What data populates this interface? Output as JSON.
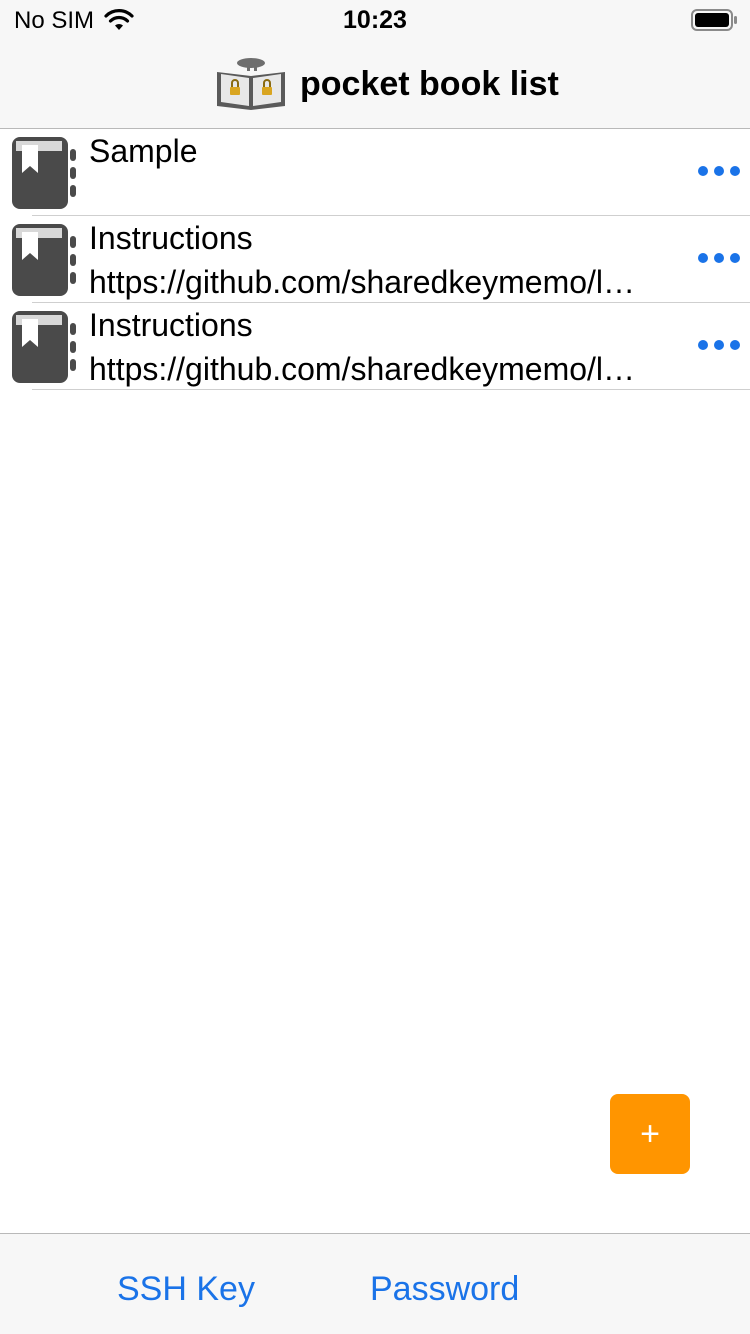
{
  "status_bar": {
    "carrier": "No SIM",
    "time": "10:23",
    "wifi_icon": "wifi-icon",
    "battery_icon": "battery-icon"
  },
  "nav": {
    "logo_icon": "book-lock-logo-icon",
    "title": "pocket book list"
  },
  "books": [
    {
      "title": "Sample",
      "subtitle": "",
      "icon": "book-icon",
      "menu_icon": "ellipsis-icon"
    },
    {
      "title": "Instructions",
      "subtitle": "https://github.com/sharedkeymemo/l…",
      "icon": "book-icon",
      "menu_icon": "ellipsis-icon"
    },
    {
      "title": "Instructions",
      "subtitle": "https://github.com/sharedkeymemo/l…",
      "icon": "book-icon",
      "menu_icon": "ellipsis-icon"
    }
  ],
  "fab": {
    "label": "+"
  },
  "tabs": [
    {
      "label": "SSH Key"
    },
    {
      "label": "Password"
    }
  ],
  "colors": {
    "accent": "#1a73e8",
    "fab": "#ff9500",
    "bar_background": "#f7f7f7",
    "icon_gray": "#4a4a4a"
  }
}
